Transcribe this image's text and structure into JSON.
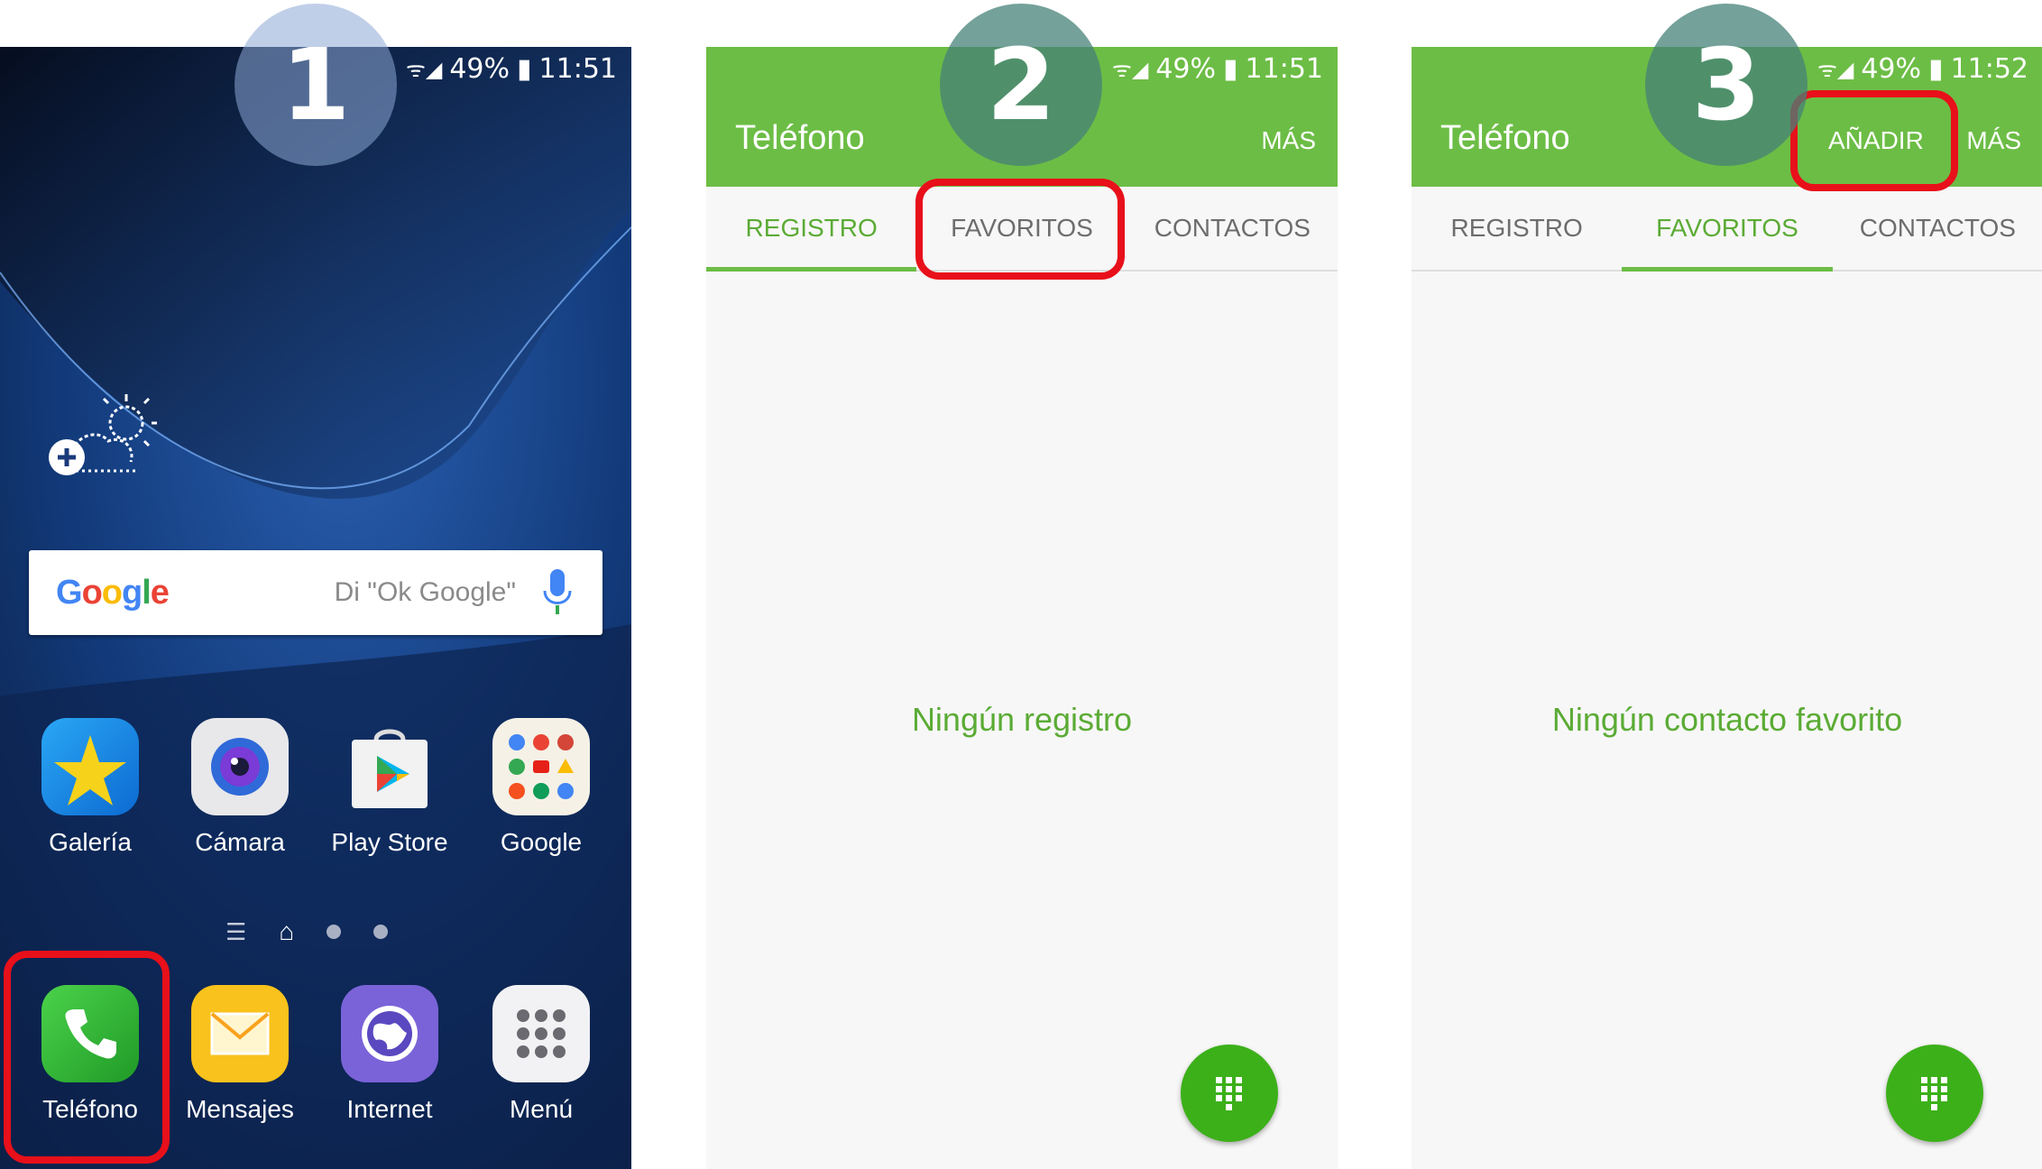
{
  "panel1": {
    "status": {
      "battery": "49%",
      "time": "11:51"
    },
    "search": {
      "logo": "Google",
      "hint": "Di \"Ok Google\"",
      "mic_icon": "mic-icon"
    },
    "apps_row": [
      {
        "label": "Galería",
        "icon": "gallery-icon"
      },
      {
        "label": "Cámara",
        "icon": "camera-icon"
      },
      {
        "label": "Play Store",
        "icon": "play-store-icon"
      },
      {
        "label": "Google",
        "icon": "google-folder-icon"
      }
    ],
    "dock": [
      {
        "label": "Teléfono",
        "icon": "phone-icon"
      },
      {
        "label": "Mensajes",
        "icon": "messages-icon"
      },
      {
        "label": "Internet",
        "icon": "internet-icon"
      },
      {
        "label": "Menú",
        "icon": "apps-menu-icon"
      }
    ]
  },
  "panel2": {
    "status": {
      "battery": "49%",
      "time": "11:51"
    },
    "title": "Teléfono",
    "more": "MÁS",
    "tabs": [
      "REGISTRO",
      "FAVORITOS",
      "CONTACTOS"
    ],
    "active_tab": "REGISTRO",
    "empty_message": "Ningún registro"
  },
  "panel3": {
    "status": {
      "battery": "49%",
      "time": "11:52"
    },
    "title": "Teléfono",
    "add": "AÑADIR",
    "more": "MÁS",
    "tabs": [
      "REGISTRO",
      "FAVORITOS",
      "CONTACTOS"
    ],
    "active_tab": "FAVORITOS",
    "empty_message": "Ningún contacto favorito"
  },
  "steps": [
    "1",
    "2",
    "3"
  ],
  "colors": {
    "accent_green": "#6cbd45",
    "highlight_red": "#e8101a",
    "fab_green": "#3cb019",
    "step_circle": "#8aa7d6"
  }
}
